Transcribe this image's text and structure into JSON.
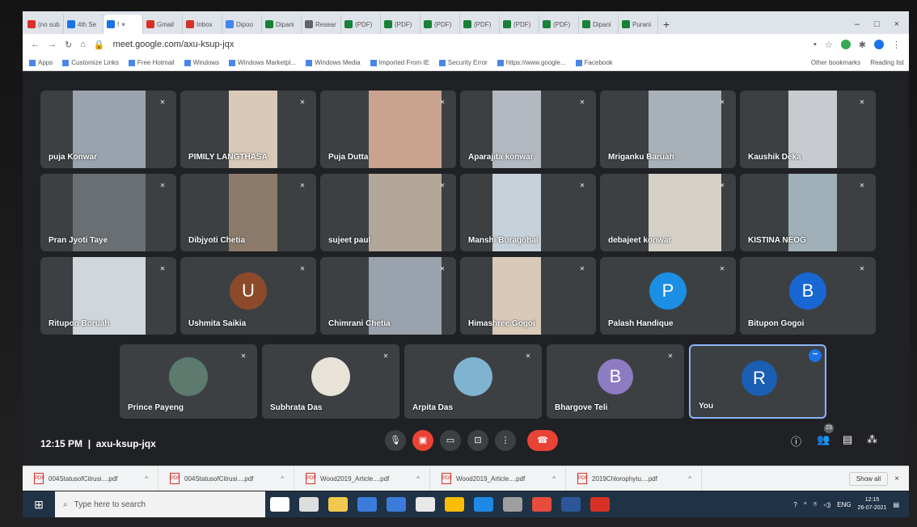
{
  "browser": {
    "tabs": [
      {
        "label": "(no sub",
        "color": "#d93025"
      },
      {
        "label": "4th Se",
        "color": "#1a73e8"
      },
      {
        "label": "!",
        "color": "#1a73e8",
        "active": true
      },
      {
        "label": "Gmail",
        "color": "#d93025"
      },
      {
        "label": "Inbox",
        "color": "#d93025"
      },
      {
        "label": "Dipoo",
        "color": "#4285f4"
      },
      {
        "label": "Dipani",
        "color": "#188038"
      },
      {
        "label": "Resear",
        "color": "#5f6368"
      },
      {
        "label": "(PDF)",
        "color": "#188038"
      },
      {
        "label": "(PDF)",
        "color": "#188038"
      },
      {
        "label": "(PDF)",
        "color": "#188038"
      },
      {
        "label": "(PDF)",
        "color": "#188038"
      },
      {
        "label": "(PDF)",
        "color": "#188038"
      },
      {
        "label": "(PDF)",
        "color": "#188038"
      },
      {
        "label": "Dipani",
        "color": "#188038"
      },
      {
        "label": "Purani",
        "color": "#188038"
      }
    ],
    "url": "meet.google.com/axu-ksup-jqx",
    "bookmarks": [
      "Apps",
      "Customize Links",
      "Free Hotmail",
      "Windows",
      "Windows Marketpl...",
      "Windows Media",
      "Imported From IE",
      "Security Error",
      "https://www.google...",
      "Facebook"
    ],
    "bookmarks_right": [
      "Other bookmarks",
      "Reading list"
    ]
  },
  "participants": [
    {
      "name": "puja Konwar"
    },
    {
      "name": "PIMILY LANGTHASA"
    },
    {
      "name": "Puja Dutta"
    },
    {
      "name": "Aparajita konwar"
    },
    {
      "name": "Mriganku Baruah"
    },
    {
      "name": "Kaushik Deka"
    },
    {
      "name": "Pran Jyoti Taye"
    },
    {
      "name": "Dibjyoti Chetia"
    },
    {
      "name": "sujeet paul"
    },
    {
      "name": "Manshi Buragohai"
    },
    {
      "name": "debajeet konwar"
    },
    {
      "name": "KISTINA NEOG"
    },
    {
      "name": "Ritupon Boruah"
    },
    {
      "name": "Ushmita Saikia",
      "initial": "U",
      "color": "#8d4a2a"
    },
    {
      "name": "Chimrani Chetia"
    },
    {
      "name": "Himashree Gogoi"
    },
    {
      "name": "Palash Handique",
      "initial": "P",
      "color": "#1a8fe3"
    },
    {
      "name": "Bitupon Gogoi",
      "initial": "B",
      "color": "#1967d2"
    },
    {
      "name": "Prince Payeng"
    },
    {
      "name": "Subhrata Das"
    },
    {
      "name": "Arpita Das"
    },
    {
      "name": "Bhargove Teli",
      "initial": "B",
      "color": "#8e7cc3"
    },
    {
      "name": "You",
      "initial": "R",
      "color": "#1a5fb4"
    }
  ],
  "meeting": {
    "time": "12:15 PM",
    "code": "axu-ksup-jqx",
    "participant_count": "23"
  },
  "downloads": [
    "004StatusofCitrusi....pdf",
    "004StatusofCitrusi....pdf",
    "Wood2019_Article....pdf",
    "Wood2019_Article....pdf",
    "2019Chlorophytu....pdf"
  ],
  "downloads_show_all": "Show all",
  "taskbar": {
    "search_placeholder": "Type here to search",
    "lang": "ENG",
    "time": "12:15",
    "date": "26-07-2021"
  }
}
